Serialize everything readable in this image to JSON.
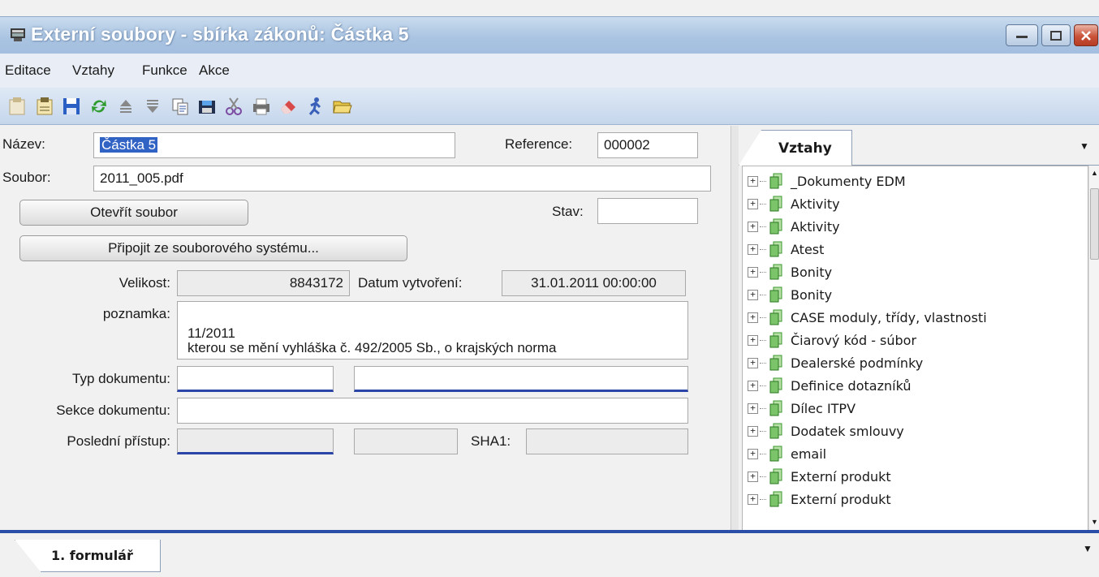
{
  "window": {
    "title": "Externí soubory - sbírka zákonů: Částka 5"
  },
  "menu": [
    "Editace",
    "Vztahy",
    "Funkce",
    "Akce"
  ],
  "toolbar_icons": [
    "new-icon",
    "open-icon",
    "save-icon",
    "refresh-icon",
    "move-up-icon",
    "move-down-icon",
    "copy-icon",
    "disk-icon",
    "scissors-icon",
    "print-icon",
    "erase-icon",
    "run-icon",
    "folder-icon"
  ],
  "form": {
    "nazev_label": "Název:",
    "nazev_value": "Částka 5",
    "reference_label": "Reference:",
    "reference_value": "000002",
    "soubor_label": "Soubor:",
    "soubor_value": "2011_005.pdf",
    "open_file_button": "Otevřít soubor",
    "stav_label": "Stav:",
    "stav_value": "",
    "attach_button": "Připojit ze souborového systému...",
    "velikost_label": "Velikost:",
    "velikost_value": "8843172",
    "datum_label": "Datum vytvoření:",
    "datum_value": "31.01.2011 00:00:00",
    "poznamka_label": "poznamka:",
    "poznamka_line1": "11/2011",
    "poznamka_line2": "kterou se mění vyhláška č. 492/2005 Sb., o krajských norma",
    "typ_label": "Typ dokumentu:",
    "typ_value1": "",
    "typ_value2": "",
    "sekce_label": "Sekce dokumentu:",
    "sekce_value": "",
    "posledni_label": "Poslední přístup:",
    "posledni_value1": "",
    "posledni_value2": "",
    "sha1_label": "SHA1:",
    "sha1_value": ""
  },
  "relations": {
    "tab_label": "Vztahy",
    "items": [
      "_Dokumenty EDM",
      "Aktivity",
      "Aktivity",
      "Atest",
      "Bonity",
      "Bonity",
      "CASE moduly, třídy, vlastnosti",
      "Čiarový kód - súbor",
      "Dealerské podmínky",
      "Definice dotazníků",
      "Dílec ITPV",
      "Dodatek smlouvy",
      "email",
      "Externí produkt",
      "Externí produkt"
    ]
  },
  "bottom": {
    "tab_label": "1. formulář"
  },
  "colors": {
    "accent_blue": "#2b4fa6",
    "selection": "#3163c5",
    "doc_icon_green": "#3a9a2e"
  }
}
